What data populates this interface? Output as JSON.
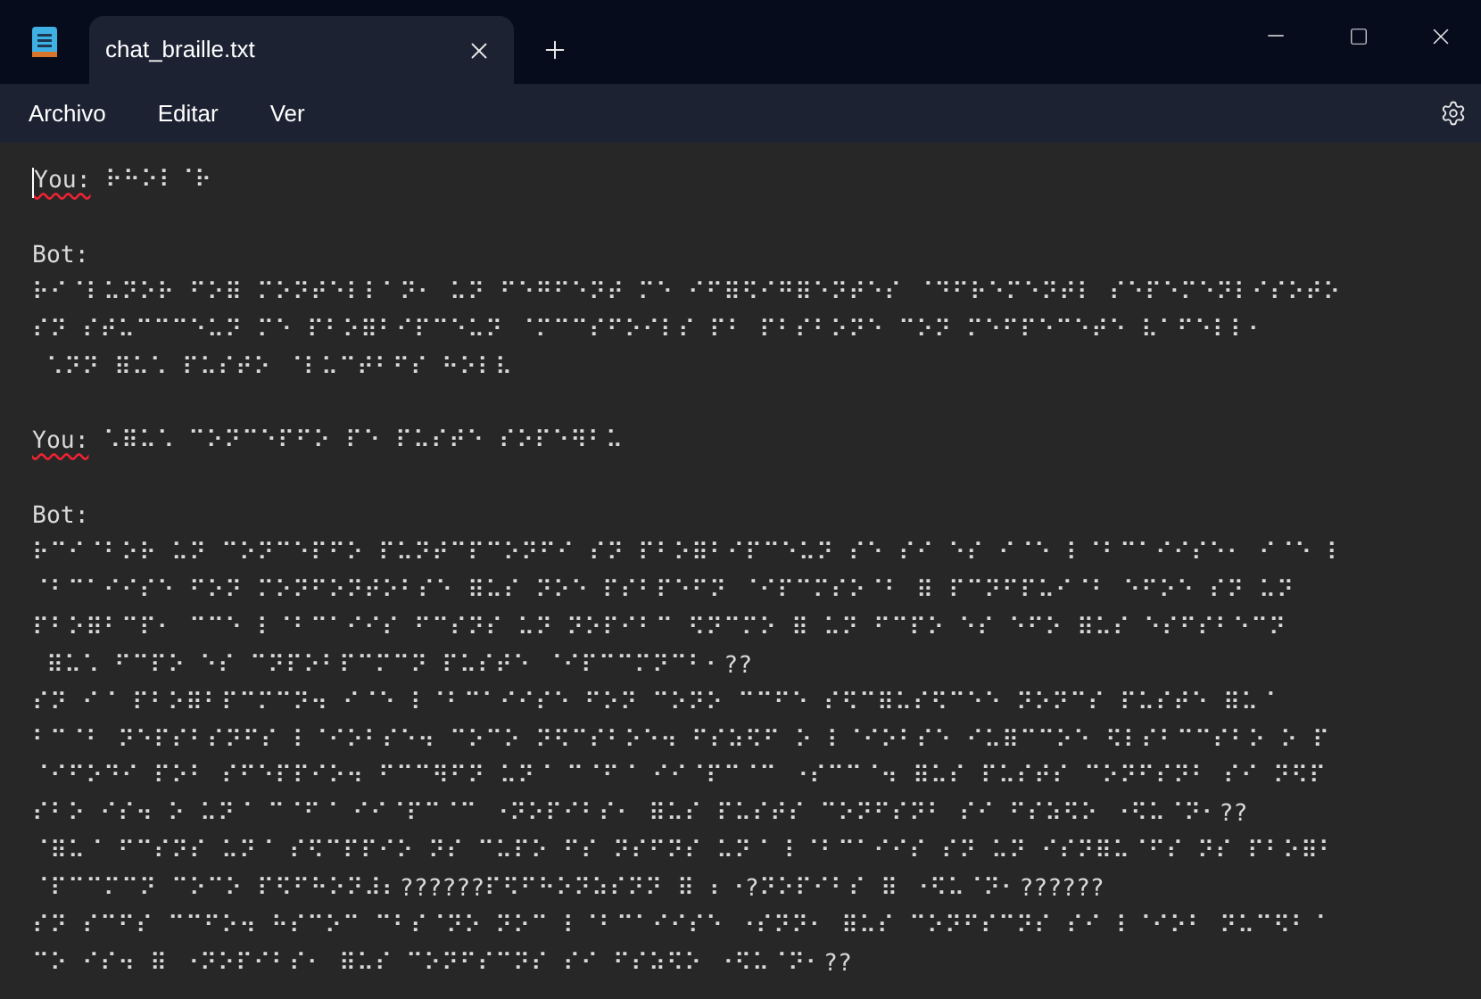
{
  "tab": {
    "title": "chat_braille.txt",
    "selected": true
  },
  "menu": [
    "Archivo",
    "Editar",
    "Ver"
  ],
  "lines": [
    {
      "kind": "speaker",
      "speaker": "You:",
      "misspelled": true,
      "text": "⠗⠓⠕⠇⠈⠗"
    },
    {
      "kind": "blank"
    },
    {
      "kind": "speaker",
      "speaker": "Bot:",
      "misspelled": false
    },
    {
      "kind": "text",
      "text": "⠗⠊⠈⠇⠥⠝⠕⠗ ⠋⠕⠿ ⠍⠕⠝⠞⠑⠇⠇⠁⠝⠂ ⠥⠝ ⠋⠑⠛⠋⠑⠝⠞ ⠍⠑ ⠊⠋⠿⠫⠊⠛⠿⠑⠝⠞⠑⠎ ⠈⠙⠋⠗⠑⠍⠑⠝⠞⠇ ⠎⠑⠏⠑⠍⠑⠝⠇⠊⠎⠕⠞⠕"
    },
    {
      "kind": "text",
      "text": "⠎⠝ ⠎⠞⠥⠉⠉⠉⠑⠥⠝ ⠍⠑ ⠏⠃⠕⠿⠃⠊⠏⠉⠑⠥⠝ ⠈⠍⠉⠉⠎⠋⠕⠊⠇⠎ ⠏⠃ ⠏⠃⠎⠃⠕⠝⠑ ⠉⠕⠝ ⠍⠑⠋⠏⠑⠉⠑⠞⠑ ⠧⠁⠋⠑⠇⠇⠂"
    },
    {
      "kind": "text",
      "text": " ⠡⠝⠝ ⠿⠥⠡ ⠏⠥⠎⠞⠕ ⠈⠇⠥⠉⠞⠃⠋⠎ ⠓⠕⠇⠧"
    },
    {
      "kind": "blank"
    },
    {
      "kind": "speaker",
      "speaker": "You:",
      "misspelled": true,
      "text": "⠡⠿⠥⠡ ⠉⠕⠝⠉⠑⠏⠋⠕ ⠏⠑ ⠏⠥⠎⠞⠑ ⠎⠕⠏⠑⠻⠃⠥"
    },
    {
      "kind": "blank"
    },
    {
      "kind": "speaker",
      "speaker": "Bot:",
      "misspelled": false
    },
    {
      "kind": "text",
      "text": "⠗⠉⠊⠈⠃⠕⠗ ⠥⠝ ⠉⠕⠝⠉⠑⠏⠋⠕ ⠏⠥⠝⠞⠉⠏⠉⠕⠝⠋⠊ ⠎⠝ ⠏⠃⠕⠿⠃⠊⠏⠉⠑⠥⠝ ⠎⠑ ⠎⠊ ⠑⠎ ⠊⠈⠑ ⠇⠈⠃⠉⠁⠊⠊⠎⠑⠂ ⠊⠈⠑ ⠇"
    },
    {
      "kind": "text",
      "text": "⠈⠃⠉⠁⠊⠊⠎⠑ ⠋⠕⠝ ⠍⠕⠝⠋⠕⠝⠞⠕⠃⠎⠑ ⠿⠥⠎ ⠝⠕⠑ ⠏⠎⠃⠏⠑⠋⠝ ⠈⠊⠏⠉⠍⠎⠕⠈⠃ ⠿ ⠏⠉⠝⠋⠏⠥⠊⠈⠃ ⠑⠋⠕⠑ ⠎⠝ ⠥⠝"
    },
    {
      "kind": "text",
      "text": "⠏⠃⠕⠿⠃⠉⠏⠂ ⠉⠉⠑ ⠇⠈⠃⠉⠁⠊⠊⠎ ⠋⠉⠎⠝⠎ ⠥⠝ ⠝⠕⠏⠊⠃⠉ ⠫⠝⠉⠍⠕ ⠿ ⠥⠝ ⠋⠉⠏⠕ ⠑⠎ ⠑⠋⠕ ⠿⠥⠎ ⠑⠎⠋⠎⠃⠑⠉⠝"
    },
    {
      "kind": "text",
      "text": " ⠿⠥⠡ ⠋⠉⠏⠕ ⠑⠎ ⠉⠝⠏⠕⠃⠏⠉⠍⠉⠝ ⠏⠥⠎⠞⠑ ⠈⠊⠏⠉⠉⠍⠝⠉⠃⠂??"
    },
    {
      "kind": "text",
      "text": "⠎⠝ ⠊⠈ ⠏⠃⠕⠿⠃⠏⠉⠍⠉⠝⠲ ⠊⠈⠑ ⠇⠈⠃⠉⠁⠊⠊⠎⠑ ⠋⠕⠝ ⠉⠕⠝⠕ ⠉⠉⠋⠑ ⠎⠫⠉⠿⠥⠎⠫⠉⠑⠑ ⠝⠕⠝⠉⠎ ⠏⠥⠎⠞⠑ ⠿⠥⠈"
    },
    {
      "kind": "text",
      "text": "⠃⠉⠈⠃ ⠝⠑⠏⠎⠃⠎⠝⠋⠎ ⠇⠈⠊⠕⠃⠎⠑⠲ ⠉⠕⠉⠕ ⠝⠫⠉⠎⠃⠕⠑⠲ ⠋⠎⠵⠫⠋ ⠕ ⠇⠈⠊⠕⠃⠎⠑ ⠊⠥⠿⠉⠉⠕⠑ ⠫⠇⠎⠃⠉⠉⠎⠃⠕ ⠕ ⠏"
    },
    {
      "kind": "text",
      "text": "⠈⠊⠋⠕⠙⠊ ⠏⠕⠃ ⠎⠋⠑⠏⠏⠊⠕⠲ ⠋⠉⠉⠻⠋⠝ ⠥⠝⠈ ⠉⠈⠋⠈ ⠊⠊⠈⠏⠉⠈⠉ ⠐⠎⠉⠉⠈⠲ ⠿⠥⠎ ⠏⠥⠎⠞⠎ ⠉⠕⠝⠋⠎⠝⠃ ⠎⠊ ⠝⠫⠏"
    },
    {
      "kind": "text",
      "text": "⠎⠃⠕ ⠊⠎⠲ ⠕ ⠥⠝⠈ ⠉⠈⠋⠈ ⠊⠊⠈⠏⠉⠈⠉ ⠐⠝⠕⠏⠊⠃⠎⠂ ⠿⠥⠎ ⠏⠥⠎⠞⠎ ⠉⠕⠝⠋⠎⠝⠃ ⠎⠊ ⠋⠎⠵⠫⠕ ⠐⠫⠥⠈⠝⠂??"
    },
    {
      "kind": "text",
      "text": "⠈⠿⠥⠈ ⠋⠉⠎⠝⠎ ⠥⠝⠈ ⠎⠫⠉⠏⠏⠊⠕ ⠝⠎ ⠉⠥⠏⠕ ⠋⠎ ⠝⠎⠋⠝⠎ ⠥⠝⠈ ⠇⠈⠃⠉⠁⠊⠊⠎ ⠎⠝ ⠥⠝ ⠊⠎⠝⠿⠥⠈⠋⠎ ⠝⠎ ⠏⠃⠕⠿⠃"
    },
    {
      "kind": "text",
      "text": "⠈⠏⠉⠉⠍⠉⠝ ⠉⠕⠉⠕ ⠏⠫⠋⠓⠕⠝⠼⠆??????⠏⠫⠋⠓⠕⠝⠵⠎⠝⠝ ⠿ ⠆⠐?⠝⠕⠏⠊⠃⠎ ⠿ ⠐⠫⠥⠈⠝⠂??????"
    },
    {
      "kind": "text",
      "text": "⠎⠝ ⠎⠉⠋⠎ ⠉⠉⠋⠕⠲ ⠓⠎⠉⠕⠉ ⠉⠃⠎⠈⠝⠕ ⠝⠕⠉ ⠇⠈⠃⠉⠁⠊⠊⠎⠑ ⠐⠎⠝⠝⠂ ⠿⠥⠎ ⠉⠕⠝⠋⠎⠉⠝⠎ ⠎⠊ ⠇⠈⠊⠕⠃ ⠝⠥⠉⠫⠃⠈"
    },
    {
      "kind": "text",
      "text": "⠉⠕ ⠊⠎⠲ ⠿ ⠐⠝⠕⠏⠊⠃⠎⠂ ⠿⠥⠎ ⠉⠕⠝⠋⠎⠉⠝⠎ ⠎⠊ ⠋⠎⠵⠫⠕ ⠐⠫⠥⠈⠝⠂??"
    }
  ]
}
